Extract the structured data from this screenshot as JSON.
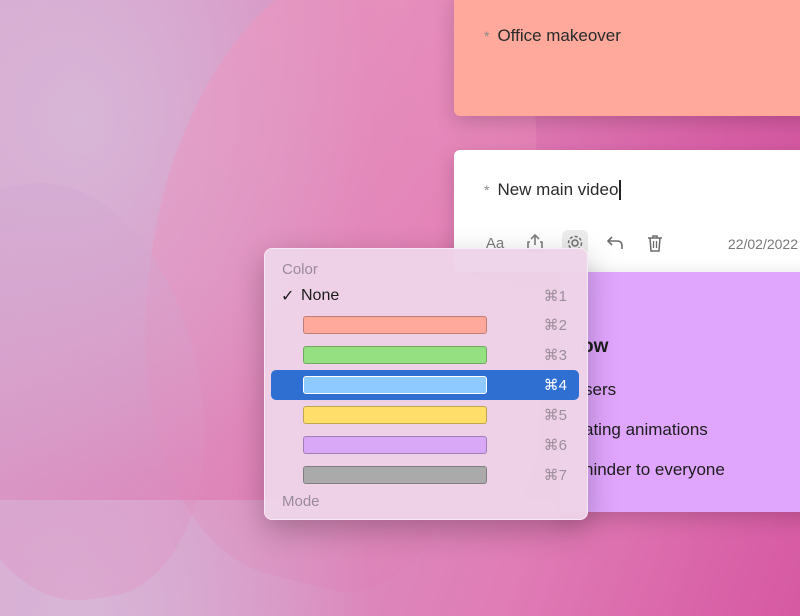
{
  "notes": {
    "office": {
      "text": "Office makeover",
      "bullet": "*"
    },
    "video": {
      "text": "New main video",
      "bullet": "*",
      "date": "22/02/2022",
      "toolbar": {
        "font_icon_label": "Aa"
      }
    },
    "purple": {
      "title_fragment": "ow",
      "line1": "sers",
      "line2": "ating animations",
      "line3": "ninder to everyone"
    }
  },
  "color_menu": {
    "header": "Color",
    "footer_partial": "Mode",
    "items": [
      {
        "label": "None",
        "checked": true,
        "shortcut": "⌘1",
        "color": null
      },
      {
        "label": "",
        "shortcut": "⌘2",
        "color": "#fea99c"
      },
      {
        "label": "",
        "shortcut": "⌘3",
        "color": "#95e081"
      },
      {
        "label": "",
        "shortcut": "⌘4",
        "color": "#8ec9ff",
        "selected": true
      },
      {
        "label": "",
        "shortcut": "⌘5",
        "color": "#ffdf6a"
      },
      {
        "label": "",
        "shortcut": "⌘6",
        "color": "#d9a8f7"
      },
      {
        "label": "",
        "shortcut": "⌘7",
        "color": "#aaaaaa"
      }
    ]
  },
  "colors": {
    "selection": "#2f6fd1",
    "note_salmon": "#fea99c",
    "note_purple": "#e0a5fd"
  }
}
